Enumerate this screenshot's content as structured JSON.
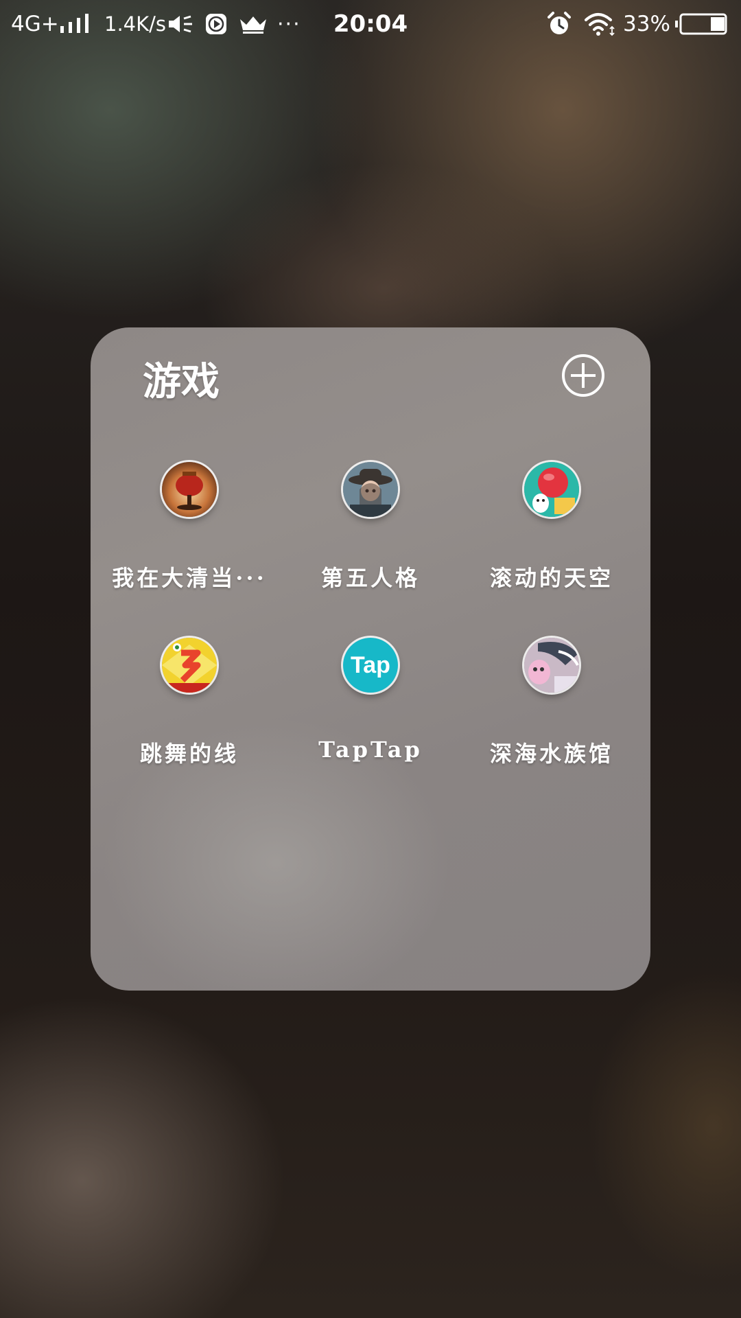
{
  "status_bar": {
    "network": "4G+",
    "speed": "1.4K/s",
    "more": "···",
    "time": "20:04",
    "battery_percent": "33%",
    "battery_level": 0.33,
    "icons": [
      "signal-icon",
      "speaker-icon",
      "media-play-icon",
      "crown-icon",
      "alarm-icon",
      "wifi-icon",
      "battery-icon"
    ]
  },
  "folder": {
    "title": "游戏",
    "add_icon": "add-circle-icon",
    "apps": [
      {
        "label": "我在大清当···",
        "icon": "app-icon-lantern"
      },
      {
        "label": "第五人格",
        "icon": "app-icon-identity-v"
      },
      {
        "label": "滚动的天空",
        "icon": "app-icon-rolling-sky"
      },
      {
        "label": "跳舞的线",
        "icon": "app-icon-dancing-line"
      },
      {
        "label": "TapTap",
        "icon": "app-icon-taptap",
        "icon_text": "Tap"
      },
      {
        "label": "深海水族馆",
        "icon": "app-icon-aquarium"
      }
    ]
  },
  "colors": {
    "folder_bg": "#8e8886",
    "taptap": "#17b8c8",
    "text": "#ffffff"
  }
}
